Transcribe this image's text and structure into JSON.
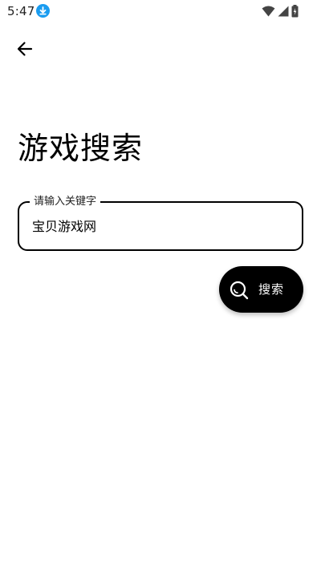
{
  "status_bar": {
    "time": "5:47",
    "icons": [
      "download-icon",
      "wifi-icon",
      "cell-signal-icon",
      "battery-icon"
    ]
  },
  "header": {
    "back_icon": "arrow-left-icon"
  },
  "main": {
    "title": "游戏搜索",
    "search_field": {
      "label": "请输入关键字",
      "value": "宝贝游戏网"
    },
    "search_button": {
      "label": "搜索",
      "icon": "search-icon"
    }
  },
  "colors": {
    "background": "#ffffff",
    "text": "#000000",
    "accent_button": "#000000",
    "download_badge": "#1a9cf0"
  }
}
